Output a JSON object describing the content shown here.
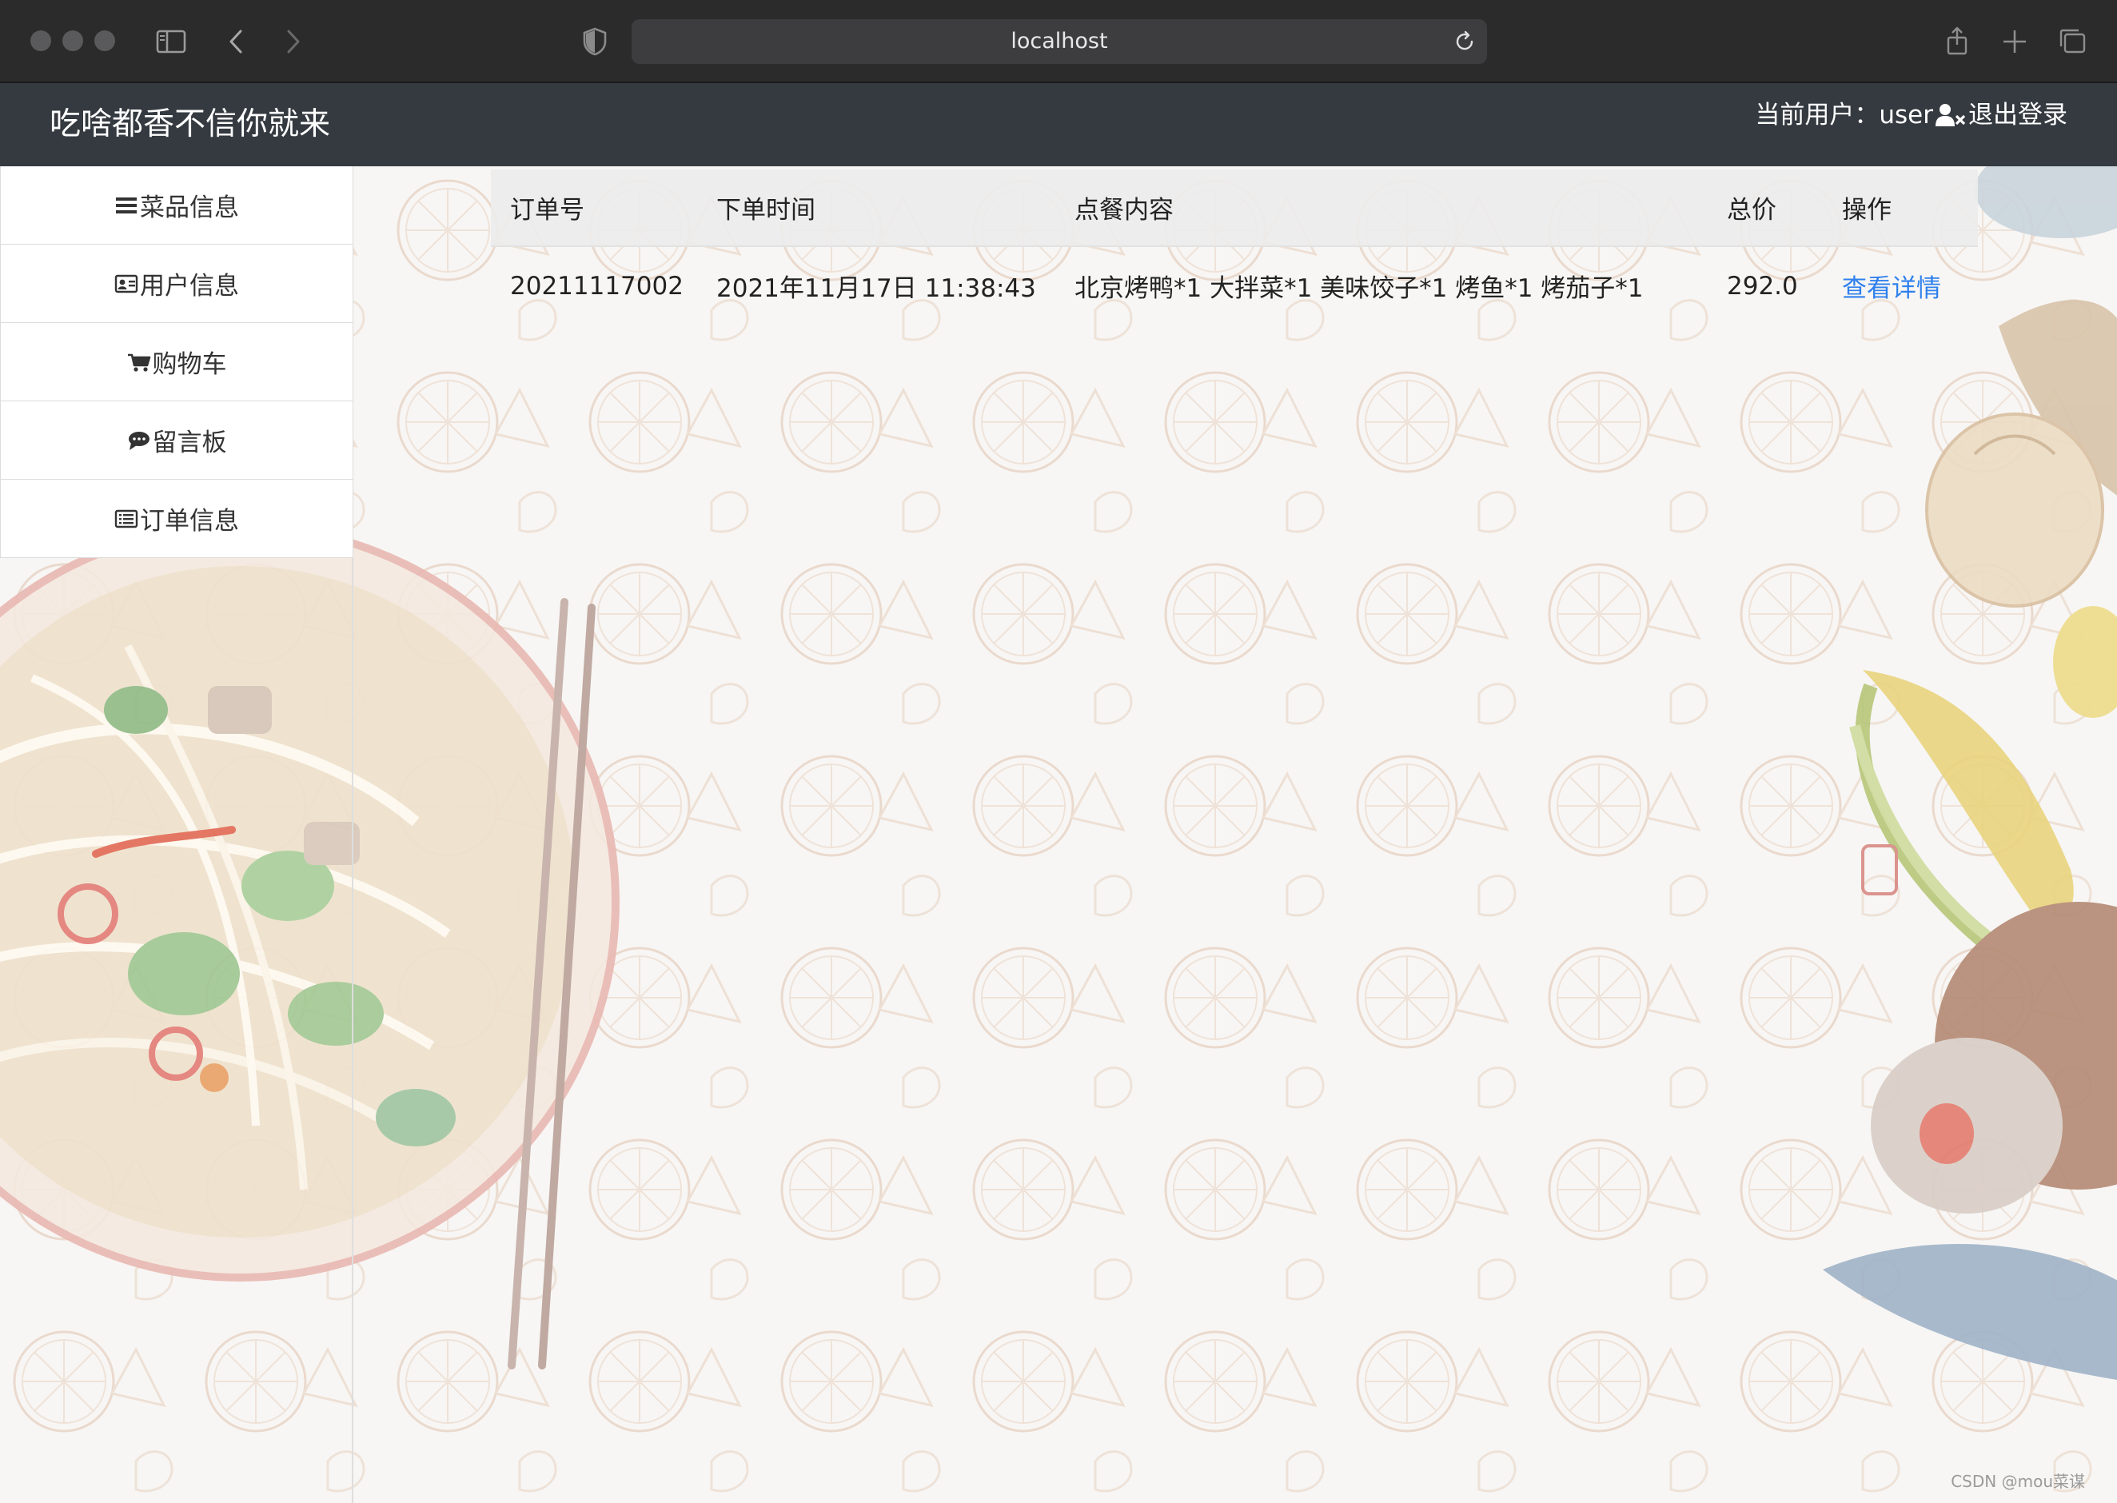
{
  "browser": {
    "url": "localhost"
  },
  "header": {
    "brand": "吃啥都香不信你就来",
    "current_user_label": "当前用户：",
    "username": "user",
    "logout_label": "退出登录"
  },
  "sidebar": {
    "items": [
      {
        "icon": "menu-bars-icon",
        "label": "菜品信息"
      },
      {
        "icon": "id-card-icon",
        "label": "用户信息"
      },
      {
        "icon": "cart-icon",
        "label": "购物车"
      },
      {
        "icon": "comment-icon",
        "label": "留言板"
      },
      {
        "icon": "list-alt-icon",
        "label": "订单信息"
      }
    ]
  },
  "orders": {
    "columns": [
      "订单号",
      "下单时间",
      "点餐内容",
      "总价",
      "操作"
    ],
    "rows": [
      {
        "order_no": "20211117002",
        "time": "2021年11月17日 11:38:43",
        "content": "北京烤鸭*1 大拌菜*1 美味饺子*1 烤鱼*1 烤茄子*1",
        "total": "292.0",
        "action": "查看详情"
      }
    ]
  },
  "watermark": "CSDN @mou菜谋",
  "colors": {
    "header_bg": "#343a40",
    "link": "#2f80ed",
    "chrome_bg": "#2b2b2c"
  }
}
